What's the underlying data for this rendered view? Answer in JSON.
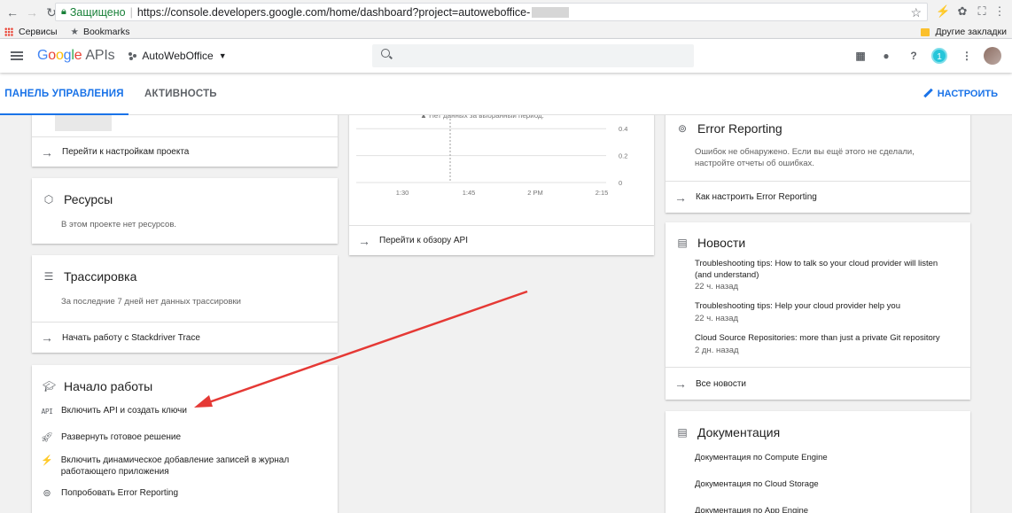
{
  "browser": {
    "secure_label": "Защищено",
    "url": "https://console.developers.google.com/home/dashboard?project=autoweboffice-",
    "bookmarks": {
      "apps": "Сервисы",
      "bookmarks": "Bookmarks",
      "other": "Другие закладки"
    }
  },
  "appbar": {
    "logo": [
      "G",
      "o",
      "o",
      "g",
      "l",
      "e"
    ],
    "product": "APIs",
    "project": "AutoWebOffice",
    "notifications_count": "1"
  },
  "tabs": {
    "dashboard": "ПАНЕЛЬ УПРАВЛЕНИЯ",
    "activity": "АКТИВНОСТЬ",
    "configure": "НАСТРОИТЬ"
  },
  "project_card": {
    "footer_link": "Перейти к настройкам проекта"
  },
  "resources_card": {
    "title": "Ресурсы",
    "desc": "В этом проекте нет ресурсов."
  },
  "trace_card": {
    "title": "Трассировка",
    "desc": "За последние 7 дней нет данных трассировки",
    "footer_link": "Начать работу с Stackdriver Trace"
  },
  "getting_started": {
    "title": "Начало работы",
    "items": [
      {
        "icon": "API",
        "label": "Включить API и создать ключи"
      },
      {
        "icon": "rocket-icon",
        "label": "Развернуть готовое решение"
      },
      {
        "icon": "log-icon",
        "label": "Включить динамическое добавление записей в журнал работающего приложения"
      },
      {
        "icon": "error-reporting-icon",
        "label": "Попробовать Error Reporting"
      }
    ]
  },
  "api_card": {
    "no_data": "Нет данных за выбранный период.",
    "footer_link": "Перейти к обзору API"
  },
  "chart_data": {
    "type": "line",
    "x": [
      "1:30",
      "1:45",
      "2 PM",
      "2:15"
    ],
    "series": [],
    "yticks": [
      0,
      0.2,
      0.4
    ],
    "ylim": [
      0,
      0.5
    ],
    "grid": true
  },
  "error_reporting_card": {
    "title": "Error Reporting",
    "desc_line1": "Ошибок не обнаружено. Если вы ещё этого не сделали,",
    "desc_line2": "настройте отчеты об ошибках.",
    "footer_link": "Как настроить Error Reporting"
  },
  "news_card": {
    "title": "Новости",
    "items": [
      {
        "line1": "Troubleshooting tips: How to talk so your cloud provider will listen",
        "line2": "(and understand)",
        "time": "22 ч. назад"
      },
      {
        "line1": "Troubleshooting tips: Help your cloud provider help you",
        "line2": "",
        "time": "22 ч. назад"
      },
      {
        "line1": "Cloud Source Repositories: more than just a private Git repository",
        "line2": "",
        "time": "2 дн. назад"
      }
    ],
    "footer_link": "Все новости"
  },
  "docs_card": {
    "title": "Документация",
    "links": [
      "Документация по Compute Engine",
      "Документация по Cloud Storage",
      "Документация по App Engine"
    ]
  },
  "colors": {
    "accent": "#1a73e8",
    "annotation_arrow": "#e53935"
  }
}
